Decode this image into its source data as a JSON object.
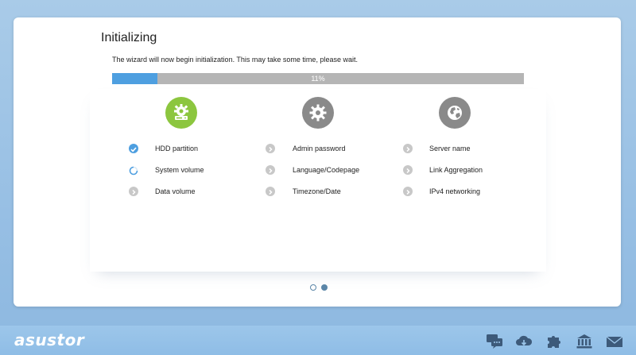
{
  "window": {
    "title": "Initializing",
    "subtitle": "The wizard will now begin initialization. This may take some time, please wait."
  },
  "progress": {
    "value": 0.11,
    "label": "11%",
    "color_fill": "#4e9fe0",
    "color_track": "#b5b5b5"
  },
  "columns": [
    {
      "icon": "gear-disk-icon",
      "active": true,
      "steps": [
        {
          "label": "HDD partition",
          "status": "done"
        },
        {
          "label": "System volume",
          "status": "in-progress"
        },
        {
          "label": "Data volume",
          "status": "pending"
        }
      ]
    },
    {
      "icon": "gear-icon",
      "active": false,
      "steps": [
        {
          "label": "Admin password",
          "status": "pending"
        },
        {
          "label": "Language/Codepage",
          "status": "pending"
        },
        {
          "label": "Timezone/Date",
          "status": "pending"
        }
      ]
    },
    {
      "icon": "globe-icon",
      "active": false,
      "steps": [
        {
          "label": "Server name",
          "status": "pending"
        },
        {
          "label": "Link Aggregation",
          "status": "pending"
        },
        {
          "label": "IPv4 networking",
          "status": "pending"
        }
      ]
    }
  ],
  "pagination": {
    "count": 2,
    "current": 2
  },
  "taskbar": {
    "brand": "asustor",
    "icons": [
      "chat-icon",
      "cloud-download-icon",
      "puzzle-icon",
      "bank-icon",
      "mail-icon"
    ]
  },
  "colors": {
    "active_green": "#8cc63f",
    "inactive_gray": "#8a8a8a",
    "done_blue": "#4e9fe0",
    "pending_gray": "#c8c8c8"
  }
}
